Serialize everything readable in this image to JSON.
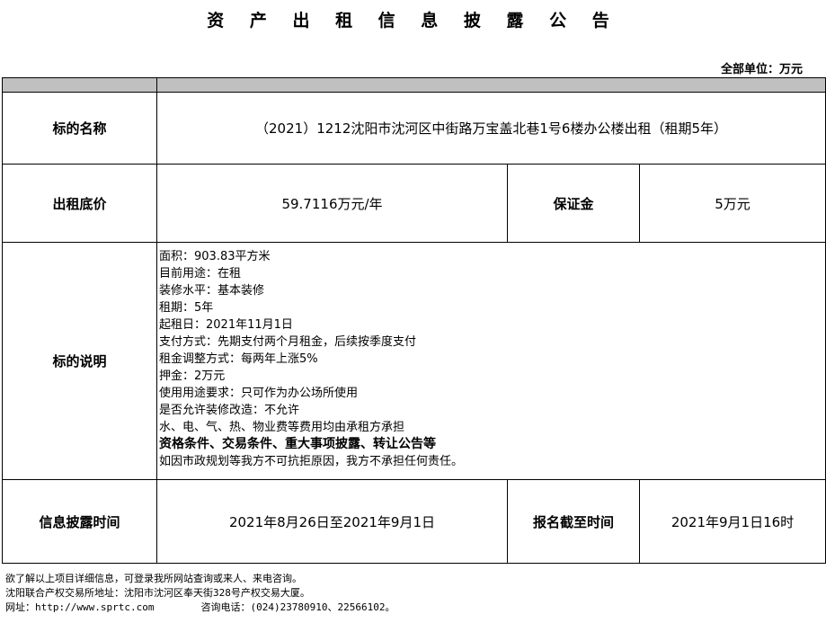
{
  "title": "资 产 出 租 信 息 披 露 公 告",
  "unit_note": "全部单位：万元",
  "rows": {
    "name": {
      "label": "标的名称",
      "value": "（2021）1212沈阳市沈河区中街路万宝盖北巷1号6楼办公楼出租（租期5年）"
    },
    "price": {
      "label": "出租底价",
      "value": "59.7116万元/年",
      "deposit_label": "保证金",
      "deposit_value": "5万元"
    },
    "description": {
      "label": "标的说明",
      "lines": [
        "面积：903.83平方米",
        "目前用途：在租",
        "装修水平：基本装修",
        "租期：5年",
        "起租日：2021年11月1日",
        "支付方式：先期支付两个月租金，后续按季度支付",
        "租金调整方式：每两年上涨5%",
        "押金：2万元",
        "使用用途要求：只可作为办公场所使用",
        "是否允许装修改造：不允许",
        "水、电、气、热、物业费等费用均由承租方承担"
      ],
      "bold_line": "资格条件、交易条件、重大事项披露、转让公告等",
      "last_line": "如因市政规划等我方不可抗拒原因，我方不承担任何责任。"
    },
    "disclosure": {
      "label": "信息披露时间",
      "value": "2021年8月26日至2021年9月1日",
      "deadline_label": "报名截至时间",
      "deadline_value": "2021年9月1日16时"
    }
  },
  "footer": {
    "line1": "欲了解以上项目详细信息，可登录我所网站查询或来人、来电咨询。",
    "line2": "沈阳联合产权交易所地址：沈阳市沈河区奉天街328号产权交易大厦。",
    "website": "网址：http://www.sprtc.com",
    "phone": "咨询电话：(024)23780910、22566102。"
  }
}
